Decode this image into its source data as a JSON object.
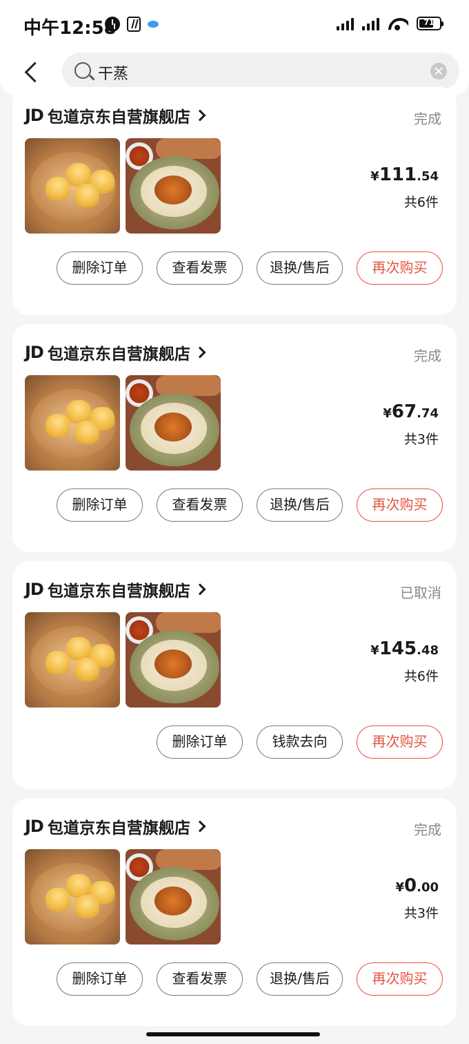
{
  "status_bar": {
    "time": "中午12:58",
    "battery": "71"
  },
  "header": {
    "search_value": "干蒸"
  },
  "orders": [
    {
      "shop_logo": "JD",
      "shop_name": "包道京东自营旗舰店",
      "status": "完成",
      "currency": "¥",
      "price_int": "111",
      "price_dec": ".54",
      "count": "共6件",
      "buttons": [
        "删除订单",
        "查看发票",
        "退换/售后",
        "再次购买"
      ]
    },
    {
      "shop_logo": "JD",
      "shop_name": "包道京东自营旗舰店",
      "status": "完成",
      "currency": "¥",
      "price_int": "67",
      "price_dec": ".74",
      "count": "共3件",
      "buttons": [
        "删除订单",
        "查看发票",
        "退换/售后",
        "再次购买"
      ]
    },
    {
      "shop_logo": "JD",
      "shop_name": "包道京东自营旗舰店",
      "status": "已取消",
      "currency": "¥",
      "price_int": "145",
      "price_dec": ".48",
      "count": "共6件",
      "buttons": [
        "删除订单",
        "钱款去向",
        "再次购买"
      ]
    },
    {
      "shop_logo": "JD",
      "shop_name": "包道京东自营旗舰店",
      "status": "完成",
      "currency": "¥",
      "price_int": "0",
      "price_dec": ".00",
      "count": "共3件",
      "buttons": [
        "删除订单",
        "查看发票",
        "退换/售后",
        "再次购买"
      ]
    }
  ],
  "colors": {
    "accent_red": "#e2523f",
    "page_bg": "#f5f5f5",
    "muted_text": "#888888"
  },
  "icons": [
    "back-icon",
    "search-icon",
    "clear-icon",
    "alarm-icon",
    "nfc-icon",
    "signal-icon",
    "wifi-icon",
    "battery-icon",
    "chevron-right-icon"
  ]
}
